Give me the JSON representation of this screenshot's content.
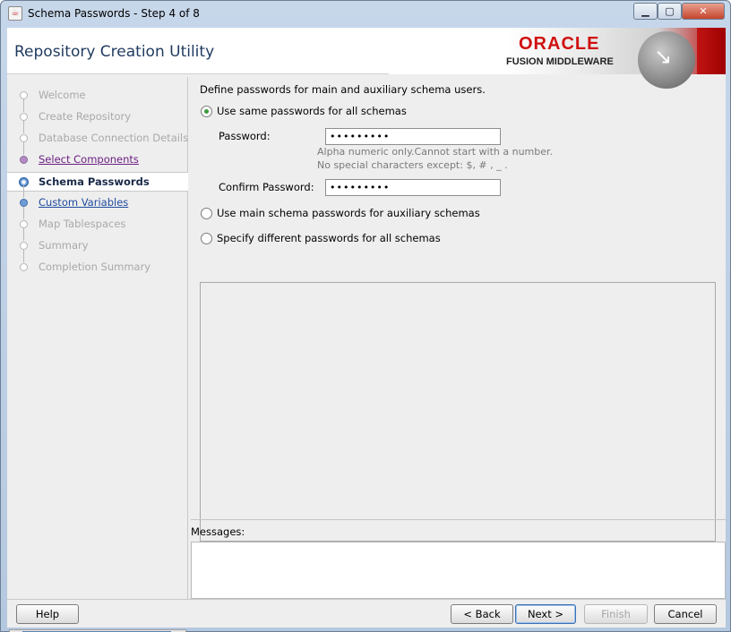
{
  "window": {
    "title": "Schema Passwords - Step 4 of 8",
    "controls": {
      "minimize": "▁",
      "maximize": "▢",
      "close": "✕"
    }
  },
  "header": {
    "app_title": "Repository Creation Utility",
    "logo_oracle": "ORACLE",
    "logo_subtitle": "FUSION MIDDLEWARE",
    "colors": {
      "oracle_red": "#d01010",
      "title_blue": "#1f3a5f"
    }
  },
  "sidebar": {
    "steps": [
      {
        "label": "Welcome",
        "state": "inactive"
      },
      {
        "label": "Create Repository",
        "state": "inactive"
      },
      {
        "label": "Database Connection Details",
        "state": "inactive"
      },
      {
        "label": "Select Components",
        "state": "done"
      },
      {
        "label": "Schema Passwords",
        "state": "current"
      },
      {
        "label": "Custom Variables",
        "state": "next"
      },
      {
        "label": "Map Tablespaces",
        "state": "inactive"
      },
      {
        "label": "Summary",
        "state": "inactive"
      },
      {
        "label": "Completion Summary",
        "state": "inactive"
      }
    ],
    "scroll_left": "◀",
    "scroll_right": "▶"
  },
  "main": {
    "description": "Define passwords for main and auxiliary schema users.",
    "options": [
      {
        "label": "Use same passwords for all schemas",
        "selected": true
      },
      {
        "label": "Use main schema passwords for auxiliary schemas",
        "selected": false
      },
      {
        "label": "Specify different passwords for all schemas",
        "selected": false
      }
    ],
    "password_label": "Password:",
    "password_value": "•••••••••",
    "hint_line1": "Alpha numeric only.Cannot start with a number.",
    "hint_line2": "No special characters except: $, # , _ .",
    "confirm_label": "Confirm Password:",
    "confirm_value": "•••••••••"
  },
  "messages": {
    "label": "Messages:"
  },
  "footer": {
    "help": "Help",
    "back": "< Back",
    "next": "Next >",
    "finish": "Finish",
    "cancel": "Cancel"
  }
}
